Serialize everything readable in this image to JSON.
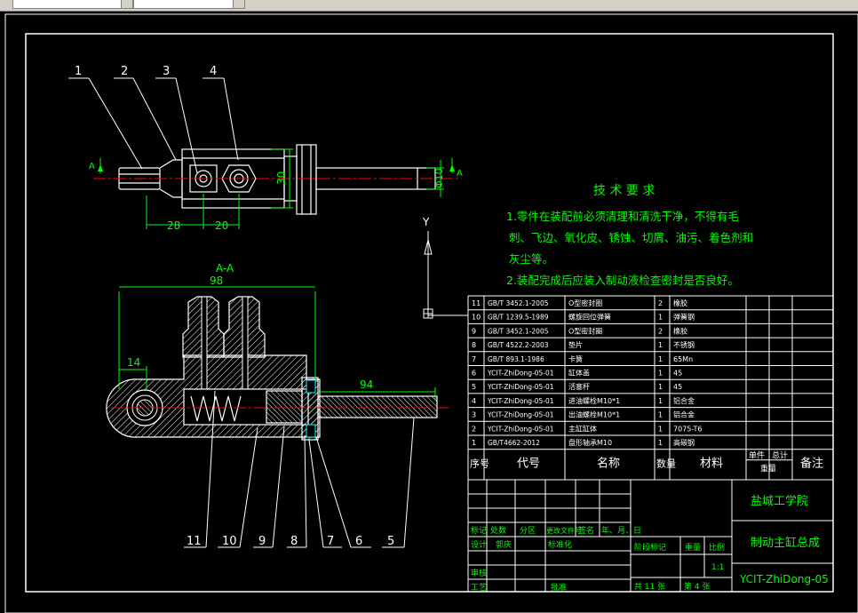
{
  "toolbar": {
    "layer_value": "",
    "style_value": ""
  },
  "drawing": {
    "section_label": "A-A",
    "balloons": [
      "1",
      "2",
      "3",
      "4"
    ],
    "section_balloons": [
      "11",
      "10",
      "9",
      "8",
      "7",
      "6",
      "5"
    ],
    "dims": {
      "d28": "28",
      "d20": "20",
      "d30": "30",
      "d10": "Φ10",
      "d98": "98",
      "d14": "14",
      "d94": "94",
      "markA": "A"
    },
    "ucs_y": "Y"
  },
  "requirements": {
    "title": "技 术 要 求",
    "lines": [
      "1.零件在装配前必须清理和清洗干净，不得有毛",
      "刺、飞边、氧化皮、锈蚀、切屑、油污、着色剂和",
      "灰尘等。",
      "2.装配完成后应装入制动液检查密封是否良好。"
    ]
  },
  "bom": {
    "rows": [
      {
        "no": "11",
        "code": "GB/T 3452.1-2005",
        "name": "O型密封圈",
        "qty": "2",
        "mat": "橡胶"
      },
      {
        "no": "10",
        "code": "GB/T 1239.5-1989",
        "name": "螺旋回位弹簧",
        "qty": "1",
        "mat": "弹簧钢"
      },
      {
        "no": "9",
        "code": "GB/T 3452.1-2005",
        "name": "O型密封圈",
        "qty": "2",
        "mat": "橡胶"
      },
      {
        "no": "8",
        "code": "GB/T 4522.2-2003",
        "name": "垫片",
        "qty": "1",
        "mat": "不锈钢"
      },
      {
        "no": "7",
        "code": "GB/T 893.1-1986",
        "name": "卡簧",
        "qty": "1",
        "mat": "65Mn"
      },
      {
        "no": "6",
        "code": "YCIT-ZhiDong-05-01",
        "name": "缸体盖",
        "qty": "1",
        "mat": "45"
      },
      {
        "no": "5",
        "code": "YCIT-ZhiDong-05-01",
        "name": "活塞杆",
        "qty": "1",
        "mat": "45"
      },
      {
        "no": "4",
        "code": "YCIT-ZhiDong-05-01",
        "name": "进油螺栓M10*1",
        "qty": "1",
        "mat": "铝合金"
      },
      {
        "no": "3",
        "code": "YCIT-ZhiDong-05-01",
        "name": "出油螺栓M10*1",
        "qty": "1",
        "mat": "铝合金"
      },
      {
        "no": "2",
        "code": "YCIT-ZhiDong-05-01",
        "name": "主缸缸体",
        "qty": "1",
        "mat": "7075-T6"
      },
      {
        "no": "1",
        "code": "GB/T4662-2012",
        "name": "盘形轴承M10",
        "qty": "1",
        "mat": "高碳钢"
      }
    ],
    "header": {
      "no": "序号",
      "code": "代号",
      "name": "名称",
      "qty": "数量",
      "mat": "材料",
      "single": "单件",
      "total": "总计",
      "weight": "重量",
      "remark": "备注"
    }
  },
  "titleblock": {
    "school": "盐城工学院",
    "drawing_name": "制动主缸总成",
    "drawing_no": "YCIT-ZhiDong-05",
    "mark": "标记",
    "count": "处数",
    "zone": "分区",
    "change_doc": "更改文件号",
    "sign": "签名",
    "date": "年、月、日",
    "design": "设计",
    "designer": "郭庆",
    "standard": "标准化",
    "stage_mark": "阶段标记",
    "weight": "重量",
    "scale": "比例",
    "scale_val": "1:1",
    "review": "审核",
    "craft": "工艺",
    "approve": "批准",
    "sheets": "共  11  张",
    "sheet_no": "第  4  张"
  },
  "colors": {
    "background": "#000000",
    "line": "#ffffff",
    "dim": "#00ff00",
    "text": "#00ff00",
    "hatch": "#ffffff"
  }
}
